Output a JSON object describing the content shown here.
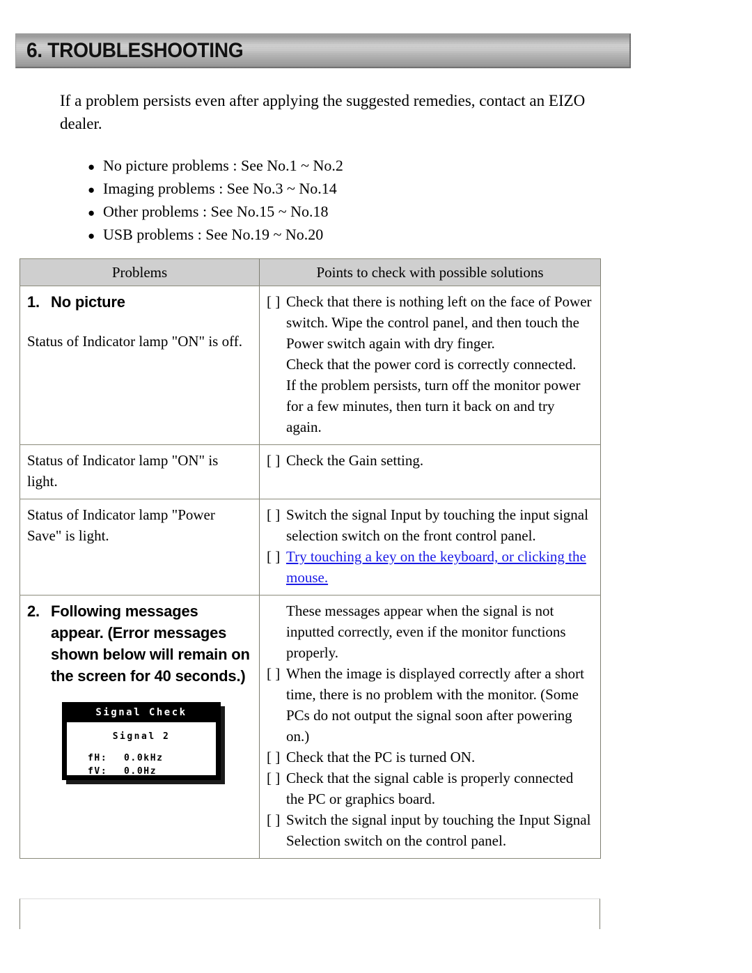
{
  "header": {
    "title": "6. TROUBLESHOOTING"
  },
  "intro": {
    "paragraph": "If a problem persists even after applying the suggested remedies, contact an EIZO dealer."
  },
  "bullets": {
    "marker": "●",
    "items": [
      "No picture problems : See No.1 ~ No.2",
      "Imaging problems : See No.3 ~ No.14",
      "Other problems : See No.15 ~ No.18",
      "USB problems : See No.19 ~ No.20"
    ]
  },
  "table": {
    "columns": {
      "problems": "Problems",
      "solutions": "Points to check with possible solutions"
    },
    "checkbox_marker": "[ ]",
    "rows": {
      "r1": {
        "number": "1.",
        "title": "No picture",
        "subtitle": "Status of Indicator lamp \"ON\" is off.",
        "checks": [
          "Check that there is nothing left on the face of Power switch. Wipe the control panel, and then touch the Power switch again with dry finger.",
          "Check that the power cord is correctly connected.",
          "If the problem persists, turn off the monitor power for a few minutes, then turn it back on and try again."
        ]
      },
      "r2": {
        "problem": "Status of Indicator lamp \"ON\" is light.",
        "check": "Check the Gain setting."
      },
      "r3": {
        "problem": "Status of Indicator lamp \"Power Save\" is light.",
        "check1": "Switch the signal Input by touching the input signal selection switch on the front control panel.",
        "check2_link": "Try touching a key on the keyboard, or clicking the mouse."
      },
      "r4": {
        "number": "2.",
        "title": "Following messages appear. (Error messages shown below will remain on the screen for 40 seconds.)",
        "intro": "These messages appear when the signal is not inputted correctly, even if the monitor functions properly.",
        "checks": [
          "When the image is displayed correctly after a short time, there is no problem with the monitor. (Some PCs do not output the signal soon after powering on.)",
          "Check that the PC is turned ON.",
          "Check that the signal cable is properly connected the PC or graphics board.",
          "Switch the signal input by touching the Input Signal Selection switch on the control panel."
        ],
        "osd": {
          "title": "Signal Check",
          "signal": "Signal 2",
          "fh_label": "fH:",
          "fh_value": "0.0kHz",
          "fv_label": "fV:",
          "fv_value": "0.0Hz"
        }
      }
    }
  },
  "colors": {
    "link": "#1a1ae6",
    "header_fill": "#cfcfcf",
    "table_border": "#8a8a7a"
  }
}
